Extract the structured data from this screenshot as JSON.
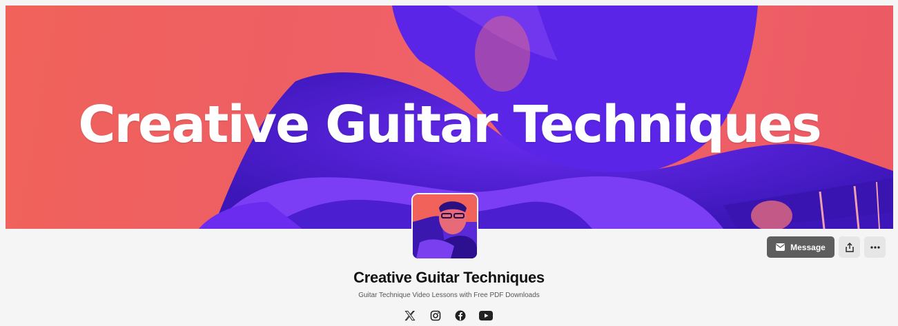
{
  "banner": {
    "title": "Creative Guitar Techniques"
  },
  "profile": {
    "name": "Creative Guitar Techniques",
    "tagline": "Guitar Technique Video Lessons with Free PDF Downloads"
  },
  "actions": {
    "message_label": "Message",
    "message_icon": "envelope-icon",
    "share_icon": "share-icon",
    "more_icon": "more-icon"
  },
  "social_links": [
    {
      "icon": "x-icon"
    },
    {
      "icon": "instagram-icon"
    },
    {
      "icon": "facebook-icon"
    },
    {
      "icon": "youtube-icon"
    }
  ],
  "colors": {
    "banner_coral": "#f0625a",
    "banner_purple": "#4a1fe0",
    "message_button": "#5e5e5e",
    "page_background": "#f5f5f5"
  }
}
